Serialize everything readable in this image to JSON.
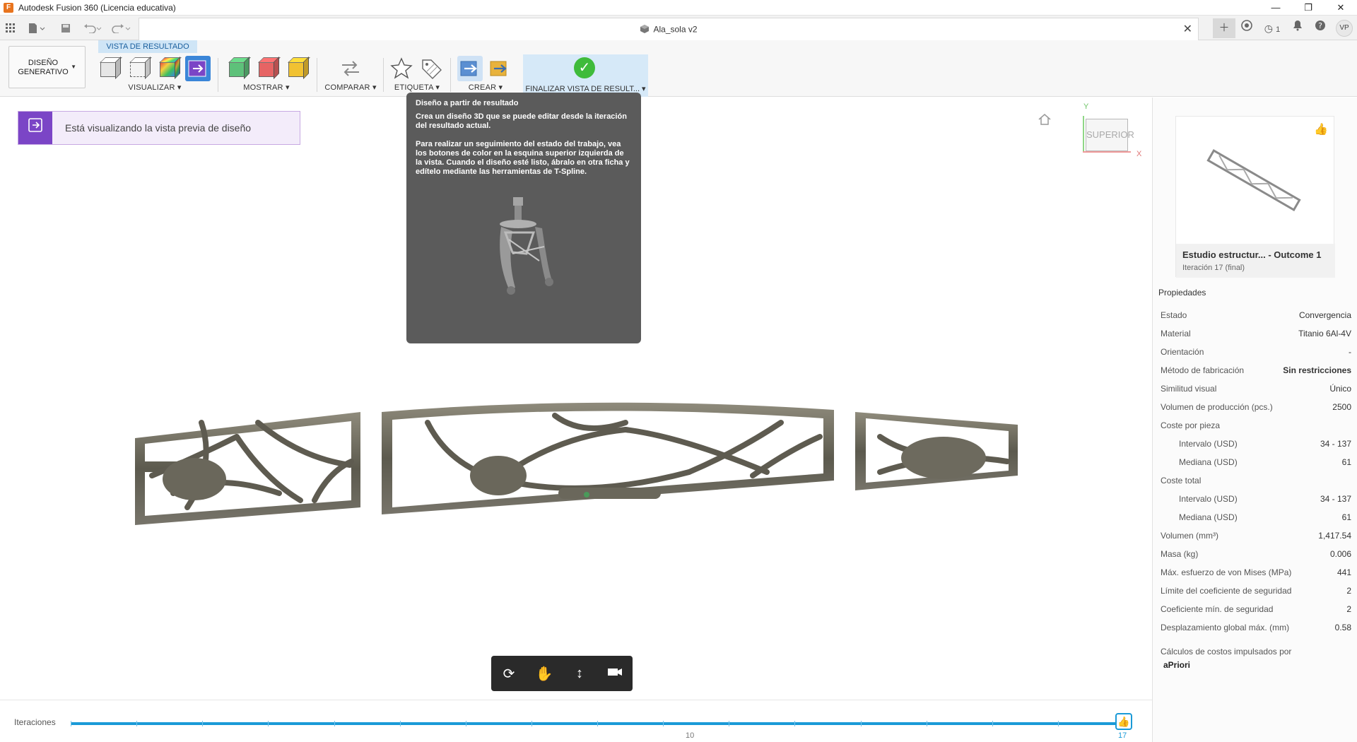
{
  "titlebar": {
    "title": "Autodesk Fusion 360 (Licencia educativa)",
    "logo": "F",
    "controls": [
      "—",
      "❐",
      "✕"
    ]
  },
  "tabbar": {
    "doc_name": "Ala_sola v2",
    "close": "✕",
    "job_count": "1",
    "user_initials": "VP"
  },
  "ribbon": {
    "workspace": "DISEÑO GENERATIVO",
    "context_tab": "VISTA DE RESULTADO",
    "groups": {
      "visualizar": "VISUALIZAR",
      "mostrar": "MOSTRAR",
      "comparar": "COMPARAR",
      "etiqueta": "ETIQUETA",
      "crear": "CREAR",
      "finalizar": "FINALIZAR VISTA DE RESULT..."
    },
    "colors": {
      "accent": "#3b86d8",
      "finish_bg": "#d6e9f8",
      "check": "#3fbb3b"
    }
  },
  "viewport": {
    "banner_text": "Está visualizando la vista previa de diseño",
    "viewcube_face": "SUPERIOR",
    "axis_y": "Y",
    "axis_x": "X"
  },
  "tooltip": {
    "title": "Diseño a partir de resultado",
    "p1": "Crea un diseño 3D que se puede editar desde la iteración del resultado actual.",
    "p2": "Para realizar un seguimiento del estado del trabajo, vea los botones de color en la esquina superior izquierda de la vista. Cuando el diseño esté listo, ábralo en otra ficha y edítelo mediante las herramientas de T-Spline."
  },
  "iterations": {
    "label": "Iteraciones",
    "total": 17,
    "current": 17,
    "mid_label": "10",
    "end_label": "17"
  },
  "outcome": {
    "title": "Estudio estructur...  - Outcome 1",
    "subtitle": "Iteración 17 (final)"
  },
  "properties": {
    "heading": "Propiedades",
    "rows": [
      {
        "label": "Estado",
        "value": "Convergencia"
      },
      {
        "label": "Material",
        "value": "Titanio 6Al-4V"
      },
      {
        "label": "Orientación",
        "value": "-"
      },
      {
        "label": "Método de fabricación",
        "value": "Sin restricciones"
      },
      {
        "label": "Similitud visual",
        "value": "Único"
      },
      {
        "label": "Volumen de producción (pcs.)",
        "value": "2500"
      },
      {
        "label": "Coste por pieza",
        "value": ""
      },
      {
        "label": "Intervalo (USD)",
        "value": "34 - 137"
      },
      {
        "label": "Mediana (USD)",
        "value": "61"
      },
      {
        "label": "Coste total",
        "value": ""
      },
      {
        "label": "Intervalo (USD)",
        "value": "34 - 137"
      },
      {
        "label": "Mediana (USD)",
        "value": "61"
      },
      {
        "label": "Volumen (mm³)",
        "value": "1,417.54"
      },
      {
        "label": "Masa (kg)",
        "value": "0.006"
      },
      {
        "label": "Máx. esfuerzo de von Mises (MPa)",
        "value": "441"
      },
      {
        "label": "Límite del coeficiente de seguridad",
        "value": "2"
      },
      {
        "label": "Coeficiente mín. de seguridad",
        "value": "2"
      },
      {
        "label": "Desplazamiento global máx. (mm)",
        "value": "0.58"
      }
    ],
    "footer": "Cálculos de costos impulsados por",
    "brand": "aPriori"
  }
}
